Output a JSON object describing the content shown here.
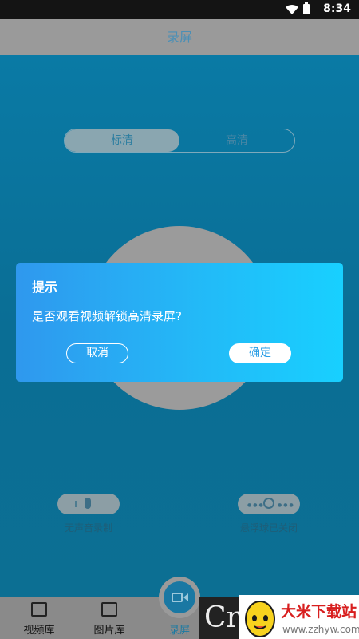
{
  "status_bar": {
    "time": "8:34",
    "wifi_icon": "wifi-icon",
    "battery_icon": "battery-icon"
  },
  "title_bar": {
    "title": "录屏"
  },
  "quality_toggle": {
    "options": [
      "标清",
      "高清"
    ],
    "selected": "标清"
  },
  "controls": {
    "audio_label": "无声音录制",
    "float_ball_label": "悬浮球已关闭"
  },
  "dialog": {
    "title": "提示",
    "message": "是否观看视频解锁高清录屏?",
    "cancel_label": "取消",
    "confirm_label": "确定"
  },
  "bottom_nav": {
    "items": [
      {
        "label": "视频库",
        "icon": "video-library-icon"
      },
      {
        "label": "图片库",
        "icon": "image-library-icon"
      },
      {
        "label": "录屏",
        "icon": "record-camera-icon"
      }
    ]
  },
  "watermark": {
    "brand": "大米下载站",
    "url": "www.zzhyw.com",
    "partial_text": "Cr"
  },
  "colors": {
    "accent": "#1a78a3",
    "dialog_start": "#2f98ee",
    "dialog_end": "#18d0ff"
  }
}
